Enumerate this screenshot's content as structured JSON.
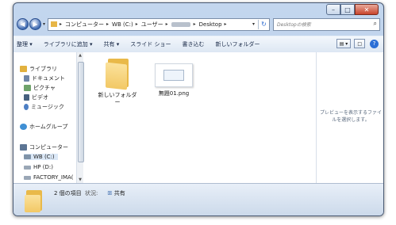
{
  "window": {
    "controls": {
      "minimize": "–",
      "maximize": "□",
      "close": "✕"
    }
  },
  "address": {
    "back": "◀",
    "forward": "▶",
    "crumbs": [
      "コンピューター",
      "WB (C:)",
      "ユーザー",
      "Desktop"
    ],
    "search_placeholder": "Desktopの検索"
  },
  "toolbar": {
    "items": [
      "整理 ▾",
      "ライブラリに追加 ▾",
      "共有 ▾",
      "スライド ショー",
      "書き込む",
      "新しいフォルダー"
    ]
  },
  "nav": {
    "items": [
      {
        "label": "ライブラリ",
        "icon": "library-icon",
        "color": "#e2b13e"
      },
      {
        "label": "ドキュメント",
        "icon": "documents-icon",
        "color": "#6f86a8"
      },
      {
        "label": "ピクチャ",
        "icon": "pictures-icon",
        "color": "#6fa36b"
      },
      {
        "label": "ビデオ",
        "icon": "videos-icon",
        "color": "#46607e"
      },
      {
        "label": "ミュージック",
        "icon": "music-icon",
        "color": "#4d7fc4"
      },
      {
        "label": "ホームグループ",
        "icon": "homegroup-icon",
        "color": "#3f8fd4"
      },
      {
        "label": "コンピューター",
        "icon": "computer-icon",
        "color": "#5c7594"
      },
      {
        "label": "WB (C:)",
        "icon": "drive-icon",
        "color": "#7f93a8"
      },
      {
        "label": "HP (D:)",
        "icon": "drive-icon",
        "color": "#9aa7b6"
      },
      {
        "label": "FACTORY_IMA(",
        "icon": "drive-icon",
        "color": "#9aa7b6"
      }
    ]
  },
  "files": [
    {
      "name": "新しいフォルダ\n ー",
      "type": "folder"
    },
    {
      "name": "無題01.png",
      "type": "png"
    }
  ],
  "preview": {
    "message": "プレビューを表示するファイルを選択します。"
  },
  "status": {
    "count": "2 個の項目",
    "state_label": "状況:",
    "shared": "共有"
  }
}
